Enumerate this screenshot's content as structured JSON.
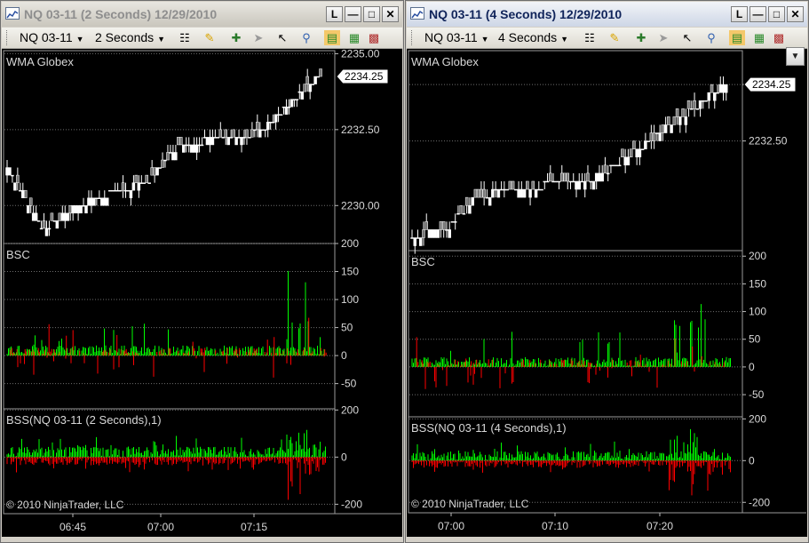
{
  "windows": [
    {
      "id": "left",
      "active": false,
      "title": "NQ 03-11 (2 Seconds)  12/29/2010",
      "toolbar": {
        "instrument": "NQ 03-11",
        "interval": "2 Seconds"
      },
      "panels": {
        "price": {
          "label": "WMA Globex",
          "ticks": [
            {
              "v": 2235.0,
              "t": "2235.00"
            },
            {
              "v": 2232.5,
              "t": "2232.50"
            },
            {
              "v": 2230.0,
              "t": "2230.00"
            }
          ],
          "range": [
            2228.75,
            2235.1
          ],
          "last_value": "2234.25",
          "last": 2234.25
        },
        "bsc": {
          "label": "BSC",
          "ticks": [
            {
              "v": 200,
              "t": "200"
            },
            {
              "v": 150,
              "t": "150"
            },
            {
              "v": 100,
              "t": "100"
            },
            {
              "v": 50,
              "t": "50"
            },
            {
              "v": 0,
              "t": "0"
            },
            {
              "v": -50,
              "t": "-50"
            }
          ],
          "range": [
            -95,
            200
          ]
        },
        "bss": {
          "label": "BSS(NQ 03-11 (2 Seconds),1)",
          "ticks": [
            {
              "v": 200,
              "t": "200"
            },
            {
              "v": 0,
              "t": "0"
            },
            {
              "v": -200,
              "t": "-200"
            }
          ],
          "range": [
            -240,
            205
          ]
        }
      },
      "time_ticks": [
        "06:45",
        "07:00",
        "07:15"
      ],
      "copyright": "© 2010 NinjaTrader, LLC"
    },
    {
      "id": "right",
      "active": true,
      "title": "NQ 03-11 (4 Seconds)  12/29/2010",
      "toolbar": {
        "instrument": "NQ 03-11",
        "interval": "4 Seconds"
      },
      "panels": {
        "price": {
          "label": "WMA Globex",
          "ticks": [
            {
              "v": 2234.25,
              "t": "2234.25"
            },
            {
              "v": 2232.5,
              "t": "2232.50"
            }
          ],
          "range": [
            2229.1,
            2235.3
          ],
          "last_value": "2234.25",
          "last": 2234.25
        },
        "bsc": {
          "label": "BSC",
          "ticks": [
            {
              "v": 200,
              "t": "200"
            },
            {
              "v": 150,
              "t": "150"
            },
            {
              "v": 100,
              "t": "100"
            },
            {
              "v": 50,
              "t": "50"
            },
            {
              "v": 0,
              "t": "0"
            },
            {
              "v": -50,
              "t": "-50"
            }
          ],
          "range": [
            -90,
            210
          ]
        },
        "bss": {
          "label": "BSS(NQ 03-11 (4 Seconds),1)",
          "ticks": [
            {
              "v": 200,
              "t": "200"
            },
            {
              "v": 0,
              "t": "0"
            },
            {
              "v": -200,
              "t": "-200"
            }
          ],
          "range": [
            -250,
            210
          ]
        }
      },
      "time_ticks": [
        "07:00",
        "07:10",
        "07:20"
      ],
      "copyright": "© 2010 NinjaTrader, LLC"
    }
  ],
  "colors": {
    "up": "#00ff00",
    "down": "#ff0000",
    "bar_up_body": "#ffffff",
    "bar_down_body": "#000000",
    "grid": "#6e6e6e",
    "axis_text": "#d8d8d8"
  }
}
